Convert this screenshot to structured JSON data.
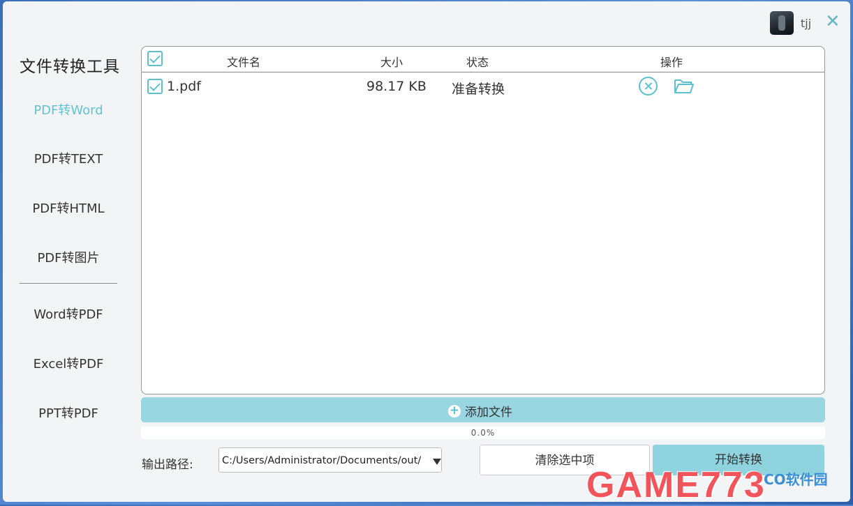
{
  "user": {
    "name": "tjj"
  },
  "app": {
    "title": "文件转换工具"
  },
  "nav": {
    "items": [
      {
        "label": "PDF转Word",
        "active": true
      },
      {
        "label": "PDF转TEXT",
        "active": false
      },
      {
        "label": "PDF转HTML",
        "active": false
      },
      {
        "label": "PDF转图片",
        "active": false
      },
      {
        "label": "Word转PDF",
        "active": false
      },
      {
        "label": "Excel转PDF",
        "active": false
      },
      {
        "label": "PPT转PDF",
        "active": false
      }
    ]
  },
  "table": {
    "columns": {
      "filename": "文件名",
      "size": "大小",
      "status": "状态",
      "actions": "操作"
    },
    "rows": [
      {
        "checked": true,
        "filename": "1.pdf",
        "size": "98.17 KB",
        "status": "准备转换"
      }
    ]
  },
  "add_file": {
    "label": "添加文件"
  },
  "progress": {
    "value": 0.0,
    "text": "0.0%"
  },
  "output": {
    "label": "输出路径:",
    "path": "C:/Users/Administrator/Documents/out/"
  },
  "buttons": {
    "clear": "清除选中项",
    "start": "开始转换"
  },
  "watermark": {
    "main": "GAME773",
    "sub": "CO软件园"
  },
  "colors": {
    "accent": "#5cc0d0",
    "active_nav": "#63c3d5",
    "button_bg": "#8fd3df",
    "watermark": "#f2545b"
  },
  "icons": {
    "close": "close-icon",
    "cancel": "cancel-circle-icon",
    "folder": "folder-open-icon",
    "plus": "plus-circle-icon",
    "caret": "caret-down-icon"
  }
}
